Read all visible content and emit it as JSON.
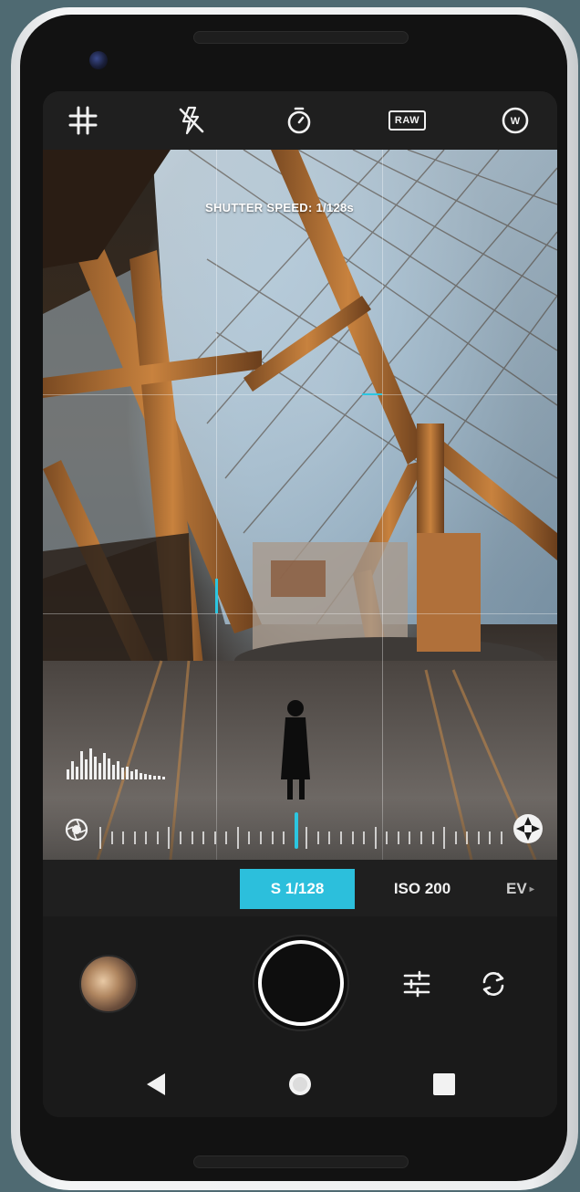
{
  "top_bar": {
    "grid_icon": "grid-icon",
    "flash_icon": "flash-off-icon",
    "timer_icon": "timer-icon",
    "raw_label": "RAW",
    "white_balance_label": "W"
  },
  "viewfinder": {
    "shutter_speed_text": "SHUTTER SPEED: 1/128s"
  },
  "histogram": {
    "levels": [
      0.3,
      0.55,
      0.4,
      0.85,
      0.6,
      0.95,
      0.7,
      0.5,
      0.8,
      0.65,
      0.45,
      0.55,
      0.35,
      0.4,
      0.25,
      0.3,
      0.2,
      0.18,
      0.15,
      0.12,
      0.1,
      0.08
    ]
  },
  "slider": {
    "left_icon": "aperture-icon",
    "right_icon": "aperture-icon",
    "position": 0.5
  },
  "modes": {
    "shutter_label": "S 1/128",
    "iso_label": "ISO 200",
    "ev_label": "EV"
  },
  "controls": {
    "settings_icon": "sliders-icon",
    "switch_camera_icon": "rotate-camera-icon"
  },
  "nav": {
    "back_icon": "back-triangle-icon",
    "home_icon": "home-circle-icon",
    "recents_icon": "recents-square-icon"
  },
  "colors": {
    "accent": "#2cbfdc"
  }
}
